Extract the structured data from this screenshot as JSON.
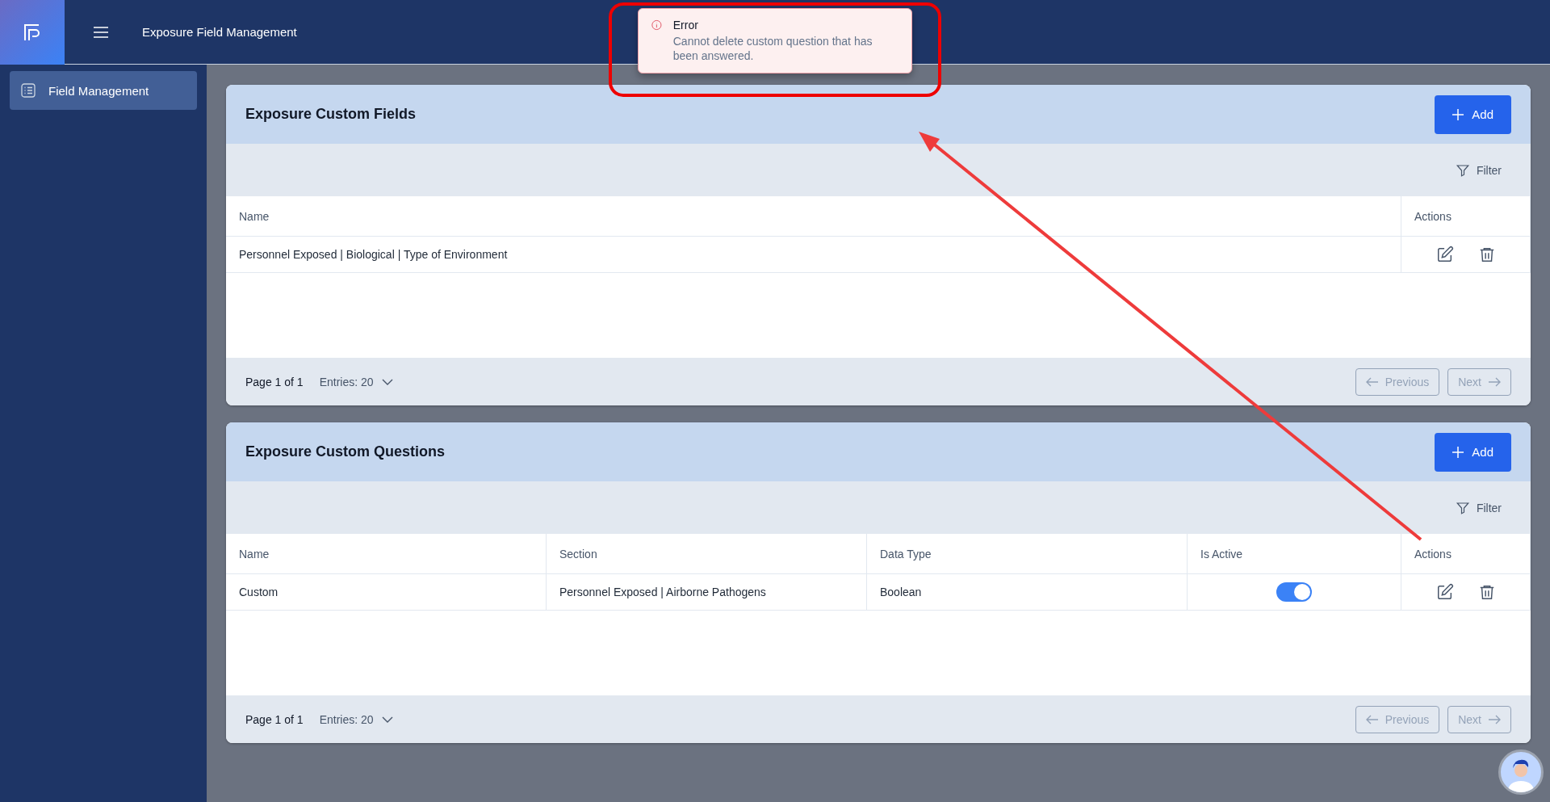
{
  "header": {
    "title": "Exposure Field Management"
  },
  "sidebar": {
    "items": [
      {
        "label": "Field Management",
        "selected": true
      }
    ]
  },
  "toast": {
    "title": "Error",
    "message": "Cannot delete custom question that has been answered."
  },
  "panels": [
    {
      "title": "Exposure Custom Fields",
      "add_label": "Add",
      "filter_label": "Filter",
      "columns": [
        {
          "label": "Name",
          "kind": "text"
        },
        {
          "label": "Actions",
          "kind": "actions"
        }
      ],
      "rows": [
        {
          "cells": [
            "Personnel Exposed | Biological | Type of Environment"
          ]
        }
      ],
      "page": "Page 1 of 1",
      "entries": "Entries: 20",
      "previous": {
        "label": "Previous",
        "disabled": true
      },
      "next": {
        "label": "Next",
        "disabled": true
      }
    },
    {
      "title": "Exposure Custom Questions",
      "add_label": "Add",
      "filter_label": "Filter",
      "columns": [
        {
          "label": "Name",
          "kind": "text"
        },
        {
          "label": "Section",
          "kind": "text"
        },
        {
          "label": "Data Type",
          "kind": "text"
        },
        {
          "label": "Is Active",
          "kind": "toggle"
        },
        {
          "label": "Actions",
          "kind": "actions"
        }
      ],
      "rows": [
        {
          "cells": [
            "Custom",
            "Personnel Exposed | Airborne Pathogens",
            "Boolean"
          ],
          "active": true
        }
      ],
      "page": "Page 1 of 1",
      "entries": "Entries: 20",
      "previous": {
        "label": "Previous",
        "disabled": true
      },
      "next": {
        "label": "Next",
        "disabled": true
      }
    }
  ]
}
